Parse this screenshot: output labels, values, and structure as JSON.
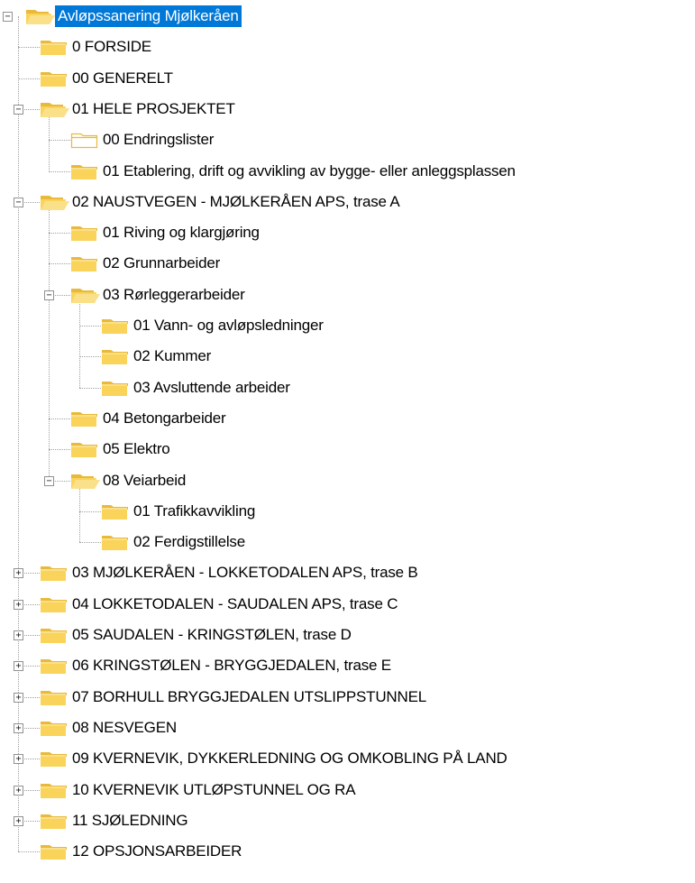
{
  "colors": {
    "folder_fill": "#f9d35a",
    "folder_tab": "#e8b93a",
    "selection": "#0078d7",
    "guides": "#a0a0a0"
  },
  "tree": {
    "items": [
      {
        "label": "Avløpssanering Mjølkeråen",
        "depth": 0,
        "toggle": "-",
        "folder": "open",
        "selected": true
      },
      {
        "label": "0 FORSIDE",
        "depth": 1,
        "toggle": "",
        "folder": "closed"
      },
      {
        "label": "00 GENERELT",
        "depth": 1,
        "toggle": "",
        "folder": "closed"
      },
      {
        "label": "01 HELE PROSJEKTET",
        "depth": 1,
        "toggle": "-",
        "folder": "open"
      },
      {
        "label": "00 Endringslister",
        "depth": 2,
        "toggle": "",
        "folder": "empty"
      },
      {
        "label": "01 Etablering, drift og avvikling av bygge- eller anleggsplassen",
        "depth": 2,
        "toggle": "",
        "folder": "closed"
      },
      {
        "label": "02 NAUSTVEGEN - MJØLKERÅEN APS, trase A",
        "depth": 1,
        "toggle": "-",
        "folder": "open"
      },
      {
        "label": "01 Riving og klargjøring",
        "depth": 2,
        "toggle": "",
        "folder": "closed"
      },
      {
        "label": "02 Grunnarbeider",
        "depth": 2,
        "toggle": "",
        "folder": "closed"
      },
      {
        "label": "03 Rørleggerarbeider",
        "depth": 2,
        "toggle": "-",
        "folder": "open"
      },
      {
        "label": "01 Vann- og avløpsledninger",
        "depth": 3,
        "toggle": "",
        "folder": "closed"
      },
      {
        "label": "02 Kummer",
        "depth": 3,
        "toggle": "",
        "folder": "closed"
      },
      {
        "label": "03 Avsluttende arbeider",
        "depth": 3,
        "toggle": "",
        "folder": "closed"
      },
      {
        "label": "04 Betongarbeider",
        "depth": 2,
        "toggle": "",
        "folder": "closed"
      },
      {
        "label": "05 Elektro",
        "depth": 2,
        "toggle": "",
        "folder": "closed"
      },
      {
        "label": "08 Veiarbeid",
        "depth": 2,
        "toggle": "-",
        "folder": "open"
      },
      {
        "label": "01 Trafikkavvikling",
        "depth": 3,
        "toggle": "",
        "folder": "closed"
      },
      {
        "label": "02 Ferdigstillelse",
        "depth": 3,
        "toggle": "",
        "folder": "closed"
      },
      {
        "label": "03 MJØLKERÅEN - LOKKETODALEN APS, trase B",
        "depth": 1,
        "toggle": "+",
        "folder": "closed"
      },
      {
        "label": "04 LOKKETODALEN - SAUDALEN APS, trase C",
        "depth": 1,
        "toggle": "+",
        "folder": "closed"
      },
      {
        "label": "05 SAUDALEN - KRINGSTØLEN, trase D",
        "depth": 1,
        "toggle": "+",
        "folder": "closed"
      },
      {
        "label": "06 KRINGSTØLEN - BRYGGJEDALEN, trase E",
        "depth": 1,
        "toggle": "+",
        "folder": "closed"
      },
      {
        "label": "07 BORHULL BRYGGJEDALEN UTSLIPPSTUNNEL",
        "depth": 1,
        "toggle": "+",
        "folder": "closed"
      },
      {
        "label": "08 NESVEGEN",
        "depth": 1,
        "toggle": "+",
        "folder": "closed"
      },
      {
        "label": "09 KVERNEVIK, DYKKERLEDNING OG OMKOBLING PÅ LAND",
        "depth": 1,
        "toggle": "+",
        "folder": "closed"
      },
      {
        "label": "10 KVERNEVIK UTLØPSTUNNEL OG RA",
        "depth": 1,
        "toggle": "+",
        "folder": "closed"
      },
      {
        "label": "11 SJØLEDNING",
        "depth": 1,
        "toggle": "+",
        "folder": "closed"
      },
      {
        "label": "12 OPSJONSARBEIDER",
        "depth": 1,
        "toggle": "",
        "folder": "closed"
      }
    ]
  }
}
